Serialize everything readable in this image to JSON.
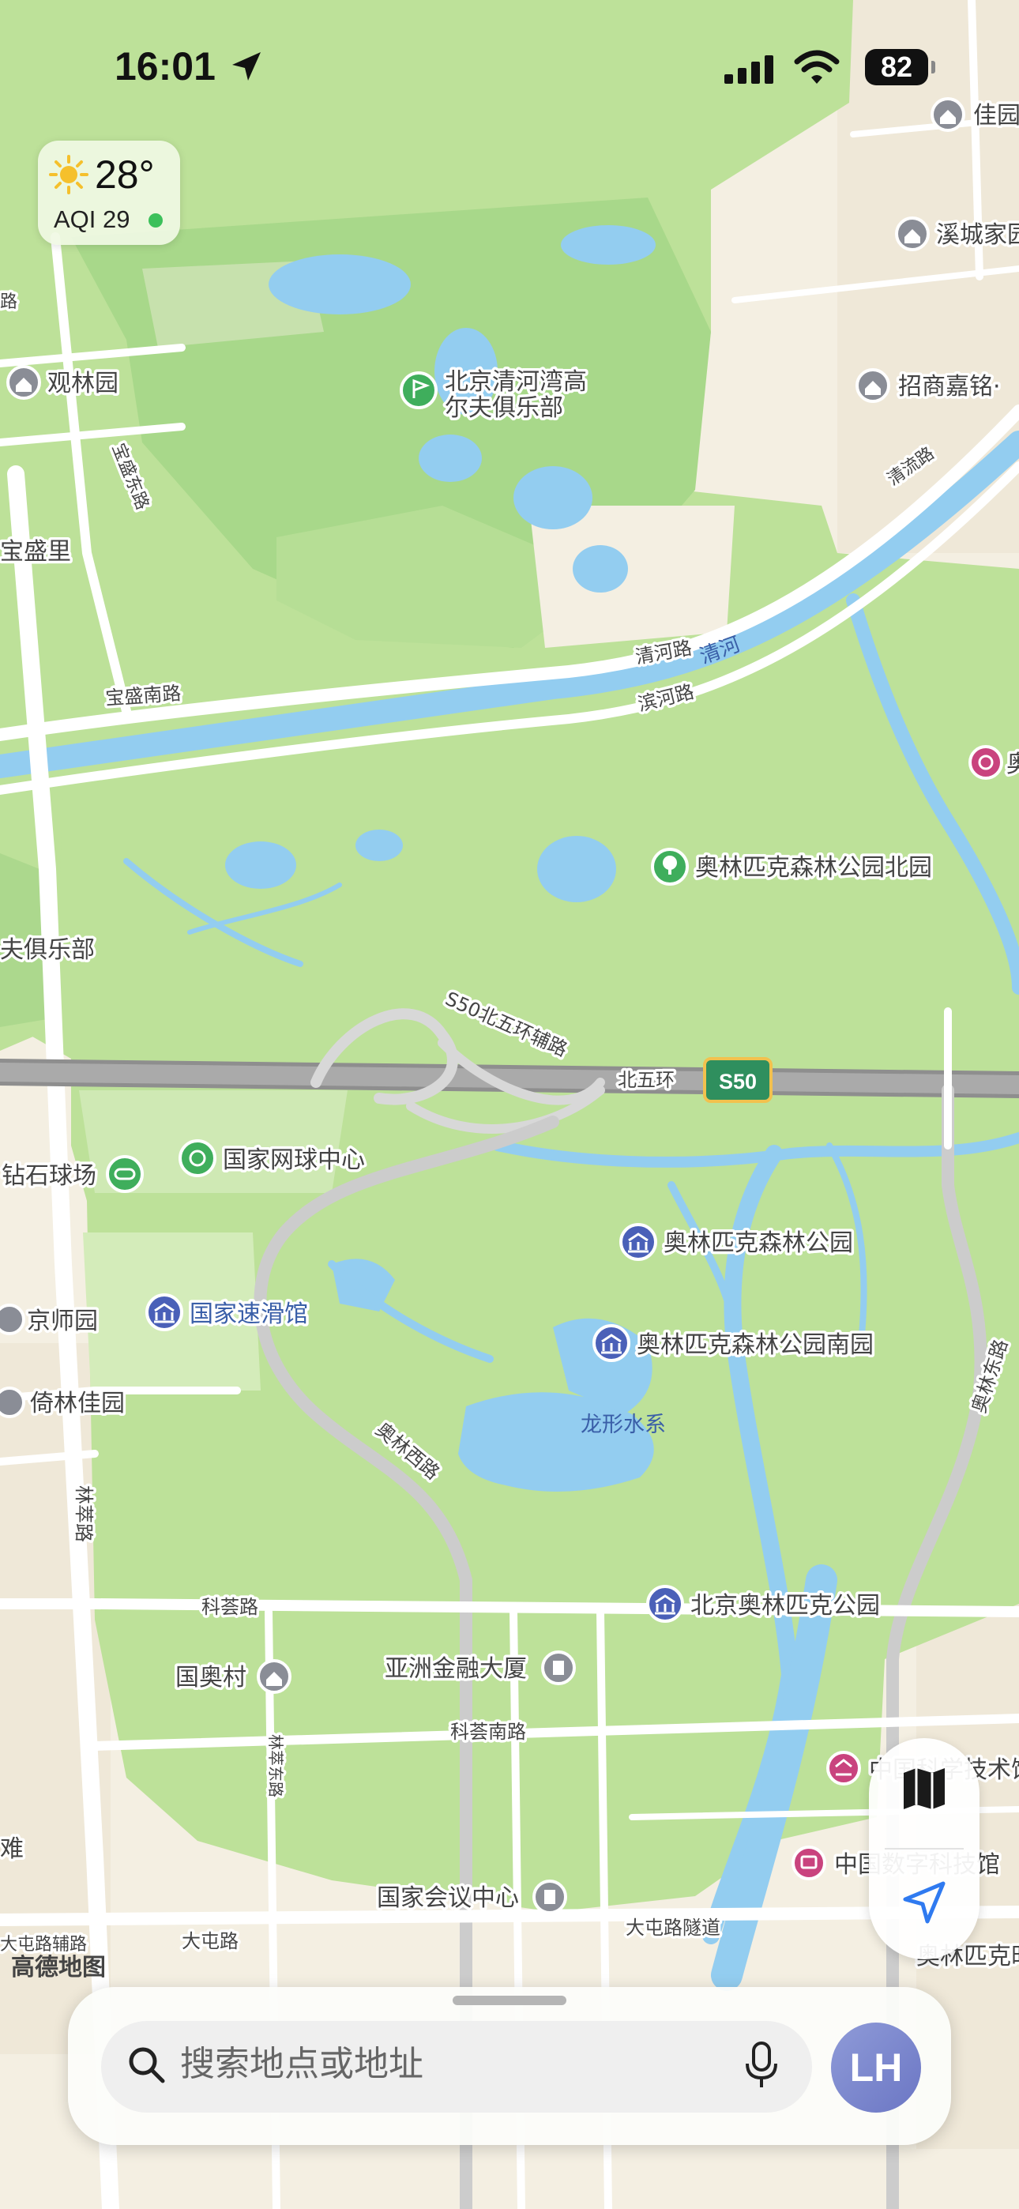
{
  "status_bar": {
    "time": "16:01",
    "battery": "82"
  },
  "weather": {
    "temperature": "28°",
    "aqi": "AQI 29",
    "aqi_status_color": "#3cc05a"
  },
  "map": {
    "provider_logo": "高德地图",
    "pois": {
      "golf_club": "北京清河湾高\n尔夫俱乐部",
      "guanlinyuan": "观林园",
      "baoshengli": "宝盛里",
      "xicheng_home": "溪城家园",
      "zhaoshang": "招商嘉铭·",
      "jiayuan_top": "佳园",
      "olympic_north": "奥林匹克森林公园北园",
      "golf_left": "夫俱乐部",
      "tennis": "国家网球中心",
      "diamond": "钻石球场",
      "olympic_forest": "奥林匹克森林公园",
      "speed_skating": "国家速滑馆",
      "olympic_south": "奥林匹克森林公园南园",
      "jingshi": "京师园",
      "yilin": "倚林佳园",
      "longxing": "龙形水系",
      "beijing_olympic_park": "北京奥林匹克公园",
      "guoao": "国奥村",
      "asia_finance": "亚洲金融大厦",
      "convention": "国家会议中心",
      "science_museum": "中国科学技术馆",
      "digital_museum": "中国数字科技馆",
      "olympic_center": "奥林匹克时代中心",
      "ao_right": "奥",
      "nan": "难"
    },
    "roads": {
      "baoshengnan": "宝盛南路",
      "baoshengdong": "宝盛东路",
      "qingheroad": "清河路",
      "binhe": "滨河路",
      "qinghe_river": "清河",
      "qingliu": "清流路",
      "s50_aux": "S50北五环辅路",
      "beiwuhuan": "北五环",
      "s50": "S50",
      "aolinxi": "奥林西路",
      "aolindong": "奥林东路",
      "linsui": "林萃路",
      "linsui_east": "林萃东路",
      "kehui": "科荟路",
      "kehuinan": "科荟南路",
      "datun": "大屯路",
      "datun_tunnel": "大屯路隧道",
      "datun_aux": "大屯路辅路",
      "left_road": "路"
    }
  },
  "search": {
    "placeholder": "搜索地点或地址",
    "avatar_initials": "LH"
  },
  "colors": {
    "park": "#bfe39a",
    "water": "#93cdf0",
    "road": "#ffffff",
    "highway": "#9b9b9b",
    "land": "#f4efe2",
    "poi_blue": "#4a60b8"
  }
}
